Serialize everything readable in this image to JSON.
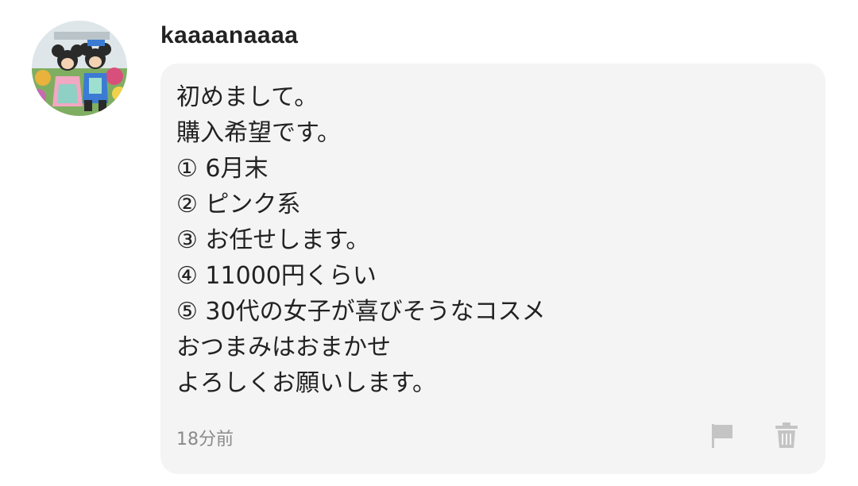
{
  "comment": {
    "username": "kaaaanaaaa",
    "avatar_icon": "avatar-photo-icon",
    "message_lines": [
      "初めまして。",
      "購入希望です。",
      "① 6月末",
      "② ピンク系",
      "③ お任せします。",
      "④ 11000円くらい",
      "⑤ 30代の女子が喜びそうなコスメ",
      "おつまみはおまかせ",
      "よろしくお願いします。"
    ],
    "timestamp": "18分前",
    "actions": {
      "report_icon": "flag-icon",
      "delete_icon": "trash-icon"
    }
  },
  "colors": {
    "bubble_background": "#f4f4f4",
    "text": "#222222",
    "muted": "#8a8a8a",
    "icon": "#c4c4c4"
  }
}
